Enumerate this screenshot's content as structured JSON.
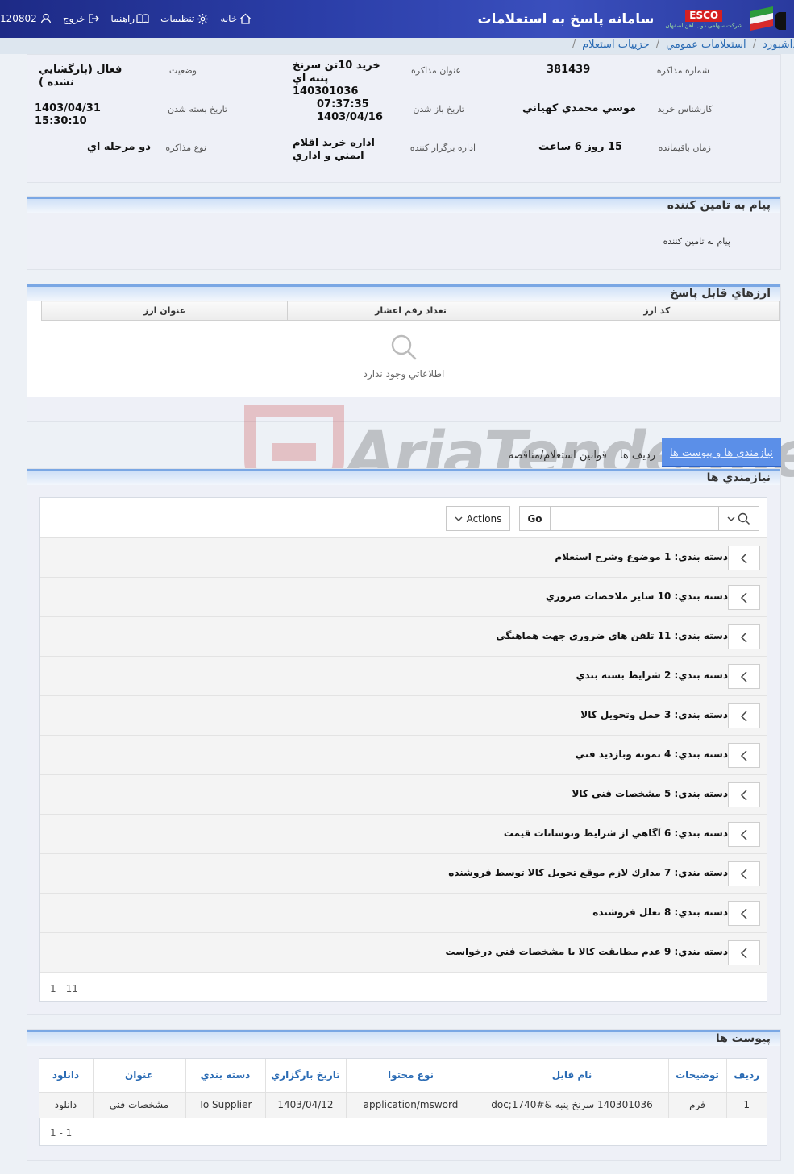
{
  "header": {
    "system_title": "سامانه پاسخ به استعلامات",
    "esco_mark": "ESCO",
    "esco_sub": "شرکت سهامی ذوب آهن اصفهان",
    "nav": {
      "home": "خانه",
      "settings": "تنظیمات",
      "help": "راهنما",
      "logout": "خروج",
      "user_id": "120802"
    }
  },
  "breadcrumb": {
    "dashboard": "داشبورد",
    "public_inquiries": "استعلامات عمومي",
    "inquiry_details": "جزييات استعلام",
    "separator": "/"
  },
  "info": {
    "negotiation_number_label": "شماره مذاكره",
    "negotiation_number": "381439",
    "negotiation_title_label": "عنوان مذاكره",
    "negotiation_title": "خريد 10تن سرنخ پنبه اي 140301036",
    "status_label": "وضعيت",
    "status": "فعال (بازگشايي نشده )",
    "expert_label": "كارشناس خريد",
    "expert": "موسي محمدي كهياني",
    "open_date_label": "تاريخ باز شدن",
    "open_time": "07:37:35",
    "open_date": "1403/04/16",
    "close_date_label": "تاريخ بسته شدن",
    "close_date": "1403/04/31 15:30:10",
    "remaining_label": "زمان باقيمانده",
    "remaining": "15 روز 6 ساعت",
    "organizer_label": "اداره برگزار كننده",
    "organizer": "اداره خريد اقلام ايمني و اداري",
    "type_label": "نوع مذاكره",
    "type": "دو مرحله اي"
  },
  "supplier_message": {
    "title": "پيام به تامين كننده",
    "body": "پيام به تامين كننده"
  },
  "currencies": {
    "title": "ارزهاي قابل پاسخ",
    "columns": [
      "كد ارز",
      "تعداد رقم اعشار",
      "عنوان ارز"
    ],
    "empty_text": "اطلاعاتي وجود ندارد"
  },
  "tabs": [
    "نيازمندي ها و پيوست ها",
    "رديف ها",
    "قوانين استعلام/مناقصه"
  ],
  "requirements": {
    "title": "نيازمندي ها",
    "go_label": "Go",
    "actions_label": "Actions",
    "category_prefix": "دسته بندي:",
    "items": [
      "1 موضوع وشرح استعلام",
      "10 ساير ملاحضات ضروري",
      "11 تلفن هاي ضروري جهت هماهنگي",
      "2 شرايط بسته بندي",
      "3 حمل وتحويل كالا",
      "4 نمونه وبازديد فني",
      "5 مشخصات فني كالا",
      "6 آگاهي از شرايط ونوسانات قيمت",
      "7 مدارك لازم موقع تحويل كالا توسط فروشنده",
      "8 تعلل فروشنده",
      "9 عدم مطابقت كالا با مشخصات فني درخواست"
    ],
    "pager": "1 - 11"
  },
  "attachments": {
    "title": "پيوست ها",
    "columns": [
      "رديف",
      "توضيحات",
      "نام فايل",
      "نوع محتوا",
      "تاريخ بارگزاري",
      "دسته بندي",
      "عنوان",
      "دانلود"
    ],
    "rows": [
      [
        "1",
        "فرم",
        "140301036 سرنخ پنبه &#1740;doc",
        "application/msword",
        "1403/04/12",
        "To Supplier",
        "مشخصات فني",
        "دانلود"
      ]
    ],
    "pager": "1 - 1"
  },
  "watermark": "AriaTender.neT",
  "colors": {
    "header_blue": "#2b3ea8",
    "link_blue": "#2a6bb4",
    "active_tab": "#5b8fe8",
    "panel_accent": "#7aa7e4"
  }
}
